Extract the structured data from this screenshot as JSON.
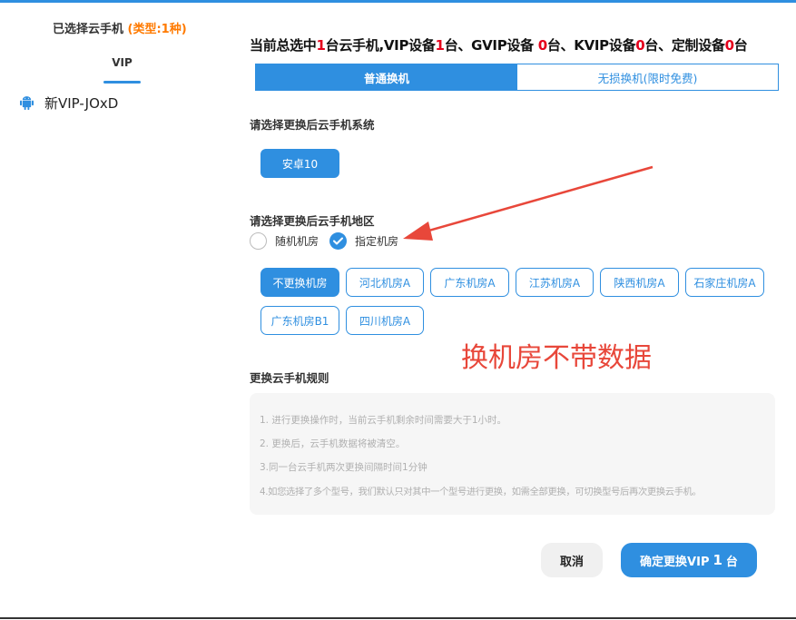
{
  "left": {
    "title": "已选择云手机",
    "type_label": "(类型:1种)",
    "tab": "VIP",
    "device": {
      "name": "新VIP-JOxD",
      "icon": "android-icon"
    }
  },
  "summary": {
    "p1": "当前总选中",
    "n1": "1",
    "p2": "台云手机,VIP设备",
    "n2": "1",
    "p3": "台、GVIP设备 ",
    "n3": "0",
    "p4": "台、KVIP设备",
    "n4": "0",
    "p5": "台、定制设备",
    "n5": "0",
    "p6": "台"
  },
  "mode_tabs": [
    "普通换机",
    "无损换机(限时免费)"
  ],
  "os_section": {
    "label": "请选择更换后云手机系统",
    "option": "安卓10"
  },
  "region_section": {
    "label": "请选择更换后云手机地区",
    "radios": [
      {
        "label": "随机机房",
        "checked": false
      },
      {
        "label": "指定机房",
        "checked": true
      }
    ],
    "rooms": [
      "不更换机房",
      "河北机房A",
      "广东机房A",
      "江苏机房A",
      "陕西机房A",
      "石家庄机房A",
      "广东机房B1",
      "四川机房A"
    ],
    "selected_room": "不更换机房"
  },
  "annotation": "换机房不带数据",
  "rules": {
    "title": "更换云手机规则",
    "items": [
      "1. 进行更换操作时，当前云手机剩余时间需要大于1小时。",
      "2. 更换后，云手机数据将被清空。",
      "3.同一台云手机两次更换间隔时间1分钟",
      "4.如您选择了多个型号，我们默认只对其中一个型号进行更换，如需全部更换，可切换型号后再次更换云手机。"
    ]
  },
  "buttons": {
    "cancel": "取消",
    "confirm_prefix": "确定更换VIP",
    "confirm_count": "1",
    "confirm_suffix": "台"
  },
  "colors": {
    "accent": "#2f8fe0",
    "highlight": "#e5001b",
    "annotation": "#e8473a",
    "type_label": "#ff7a00"
  }
}
